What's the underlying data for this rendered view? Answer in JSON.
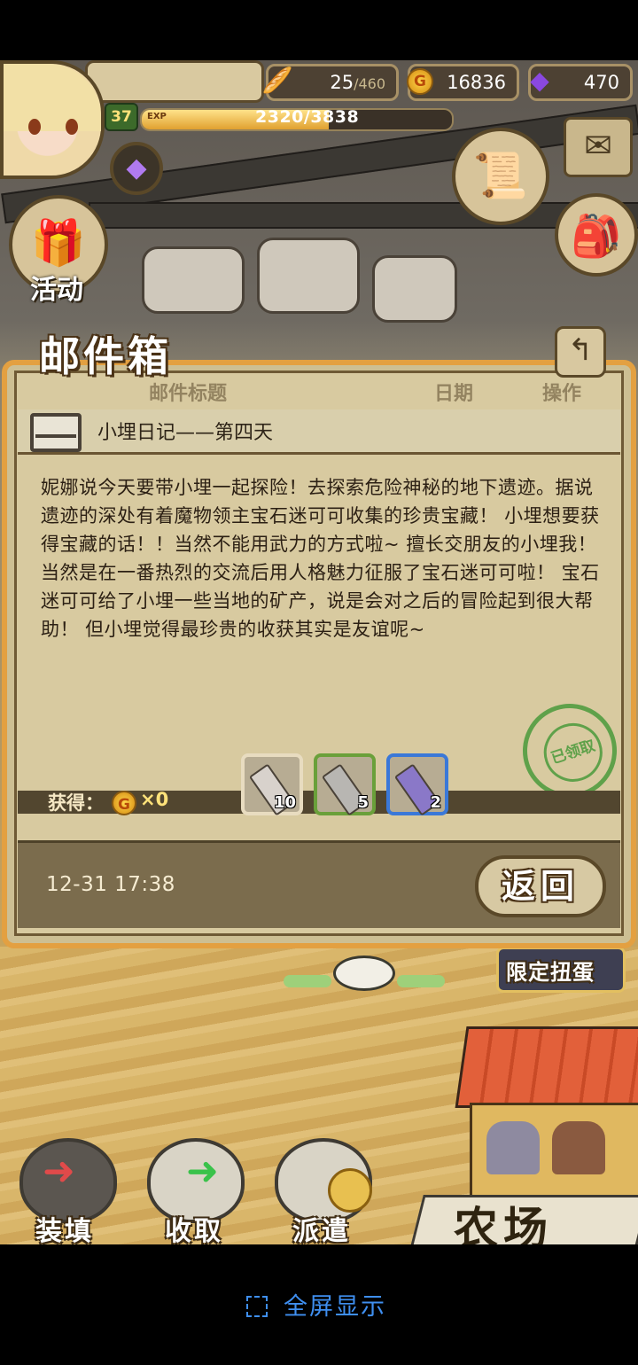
{
  "hud": {
    "level": "37",
    "exp_label": "EXP",
    "exp_value": "2320/3838",
    "exp_fraction": 0.604,
    "stamina": "25",
    "stamina_max": "/460",
    "gold": "16836",
    "gems": "470",
    "event_label": "活动"
  },
  "mail": {
    "panel_title": "邮件箱",
    "columns": [
      "邮件标题",
      "日期",
      "操作"
    ],
    "subject": "小埋日记——第四天",
    "body": "妮娜说今天要带小埋一起探险！去探索危险神秘的地下遗迹。据说遗迹的深处有着魔物领主宝石迷可可收集的珍贵宝藏！ 小埋想要获得宝藏的话！！当然不能用武力的方式啦~ 擅长交朋友的小埋我！当然是在一番热烈的交流后用人格魅力征服了宝石迷可可啦！ 宝石迷可可给了小埋一些当地的矿产，说是会对之后的冒险起到很大帮助！ 但小埋觉得最珍贵的收获其实是友谊呢~",
    "stamp_text": "已领取",
    "reward_label": "获得：",
    "coin_glyph": "G",
    "coin_count": "×0",
    "items": [
      {
        "qty": "10",
        "border": "#e8dcc0",
        "color": "#d8d2cc"
      },
      {
        "qty": "5",
        "border": "#6aa03a",
        "color": "#b8b6b2"
      },
      {
        "qty": "2",
        "border": "#3a78d8",
        "color": "#8a78c8"
      }
    ],
    "timestamp": "12-31 17:38",
    "return_label": "返回"
  },
  "bottom": {
    "load_label": "装填",
    "collect_label": "收取",
    "dispatch_label": "派遣",
    "farm_label": "农场",
    "gacha_label": "限定扭蛋"
  },
  "fullscreen_label": "全屏显示"
}
